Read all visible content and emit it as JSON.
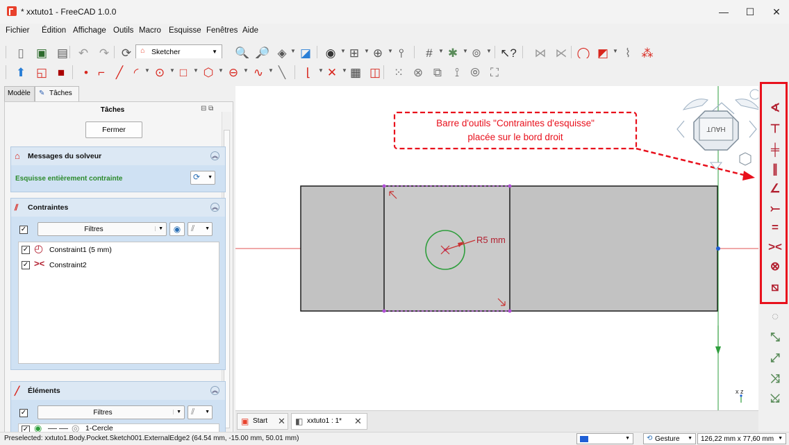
{
  "window": {
    "title": "* xxtuto1 - FreeCAD 1.0.0",
    "minimize": "—",
    "maximize": "☐",
    "close": "✕"
  },
  "menu": [
    "Fichier",
    "Édition",
    "Affichage",
    "Outils",
    "Macro",
    "Esquisse",
    "Fenêtres",
    "Aide"
  ],
  "toolbar": {
    "workbench": "Sketcher"
  },
  "left_panel": {
    "tabs": [
      "Modèle",
      "Tâches"
    ],
    "header": "Tâches",
    "close_button": "Fermer",
    "solver": {
      "title": "Messages du solveur",
      "status": "Esquisse entièrement contrainte"
    },
    "constraints": {
      "title": "Contraintes",
      "filter": "Filtres",
      "items": [
        "Constraint1 (5 mm)",
        "Constraint2"
      ]
    },
    "elements": {
      "title": "Éléments",
      "filter": "Filtres",
      "items": [
        "1-Cercle"
      ]
    }
  },
  "viewport": {
    "annotation_line1": "Barre d'outils \"Contraintes d'esquisse\"",
    "annotation_line2": "placée sur le bord droit",
    "dimension_label": "R5 mm",
    "navcube_face": "HAUT",
    "axis_label": "x z"
  },
  "doc_tabs": [
    {
      "label": "Start"
    },
    {
      "label": "xxtuto1 : 1*"
    }
  ],
  "status": {
    "message": "Preselected: xxtuto1.Body.Pocket.Sketch001.ExternalEdge2 (64.54 mm, -15.00 mm, 50.01 mm)",
    "nav_style": "Gesture",
    "dimensions": "126,22 mm x 77,60 mm"
  },
  "colors": {
    "accent_red": "#e8101c",
    "constraint_red": "#b22030",
    "sketch_green": "#2e9e3c",
    "geometry_purple": "#b04fd6"
  }
}
